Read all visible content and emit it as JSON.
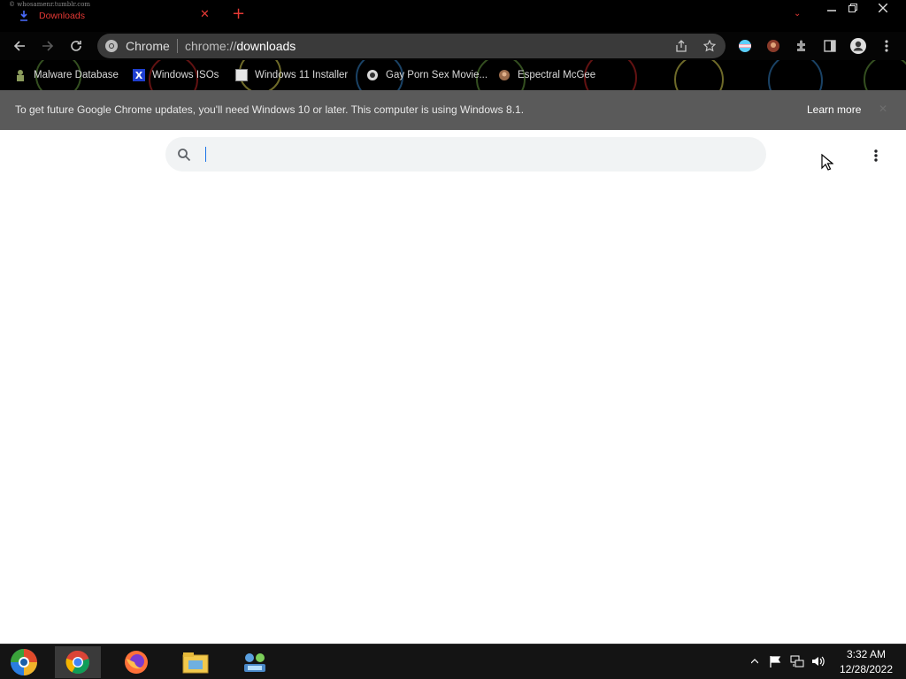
{
  "titlebar": {
    "watermark": "© whosamenr.tumblr.com",
    "tab": {
      "title": "Downloads",
      "icon": "download-icon",
      "close_icon": "close-icon"
    },
    "newtab_icon": "plus-icon",
    "window_controls": [
      "minimize-icon",
      "restore-icon",
      "close-icon"
    ],
    "accent_color": "#e53935"
  },
  "toolbar": {
    "back_icon": "arrow-left-icon",
    "forward_icon": "arrow-right-icon",
    "reload_icon": "reload-icon",
    "omnibox": {
      "chip_label": "Chrome",
      "url_prefix": "chrome://",
      "url_host": "downloads"
    },
    "share_icon": "share-icon",
    "bookmark_icon": "star-icon",
    "right_icons": [
      "profile-flag-icon",
      "extension-avatar-icon",
      "puzzle-icon",
      "side-panel-icon",
      "account-icon",
      "kebab-menu-icon"
    ]
  },
  "bookmarks": [
    {
      "label": "Malware Database",
      "icon": "bookmark-favicon"
    },
    {
      "label": "Windows ISOs",
      "icon": "x-favicon"
    },
    {
      "label": "Windows 11 Installer",
      "icon": "page-favicon"
    },
    {
      "label": "Gay Porn Sex Movie...",
      "icon": "site-favicon"
    },
    {
      "label": "Espectral McGee",
      "icon": "site-favicon"
    }
  ],
  "infobar": {
    "message": "To get future Google Chrome updates, you'll need Windows 10 or later. This computer is using Windows 8.1.",
    "link": "Learn more",
    "close_icon": "close-icon"
  },
  "downloads_page": {
    "search_placeholder": "",
    "search_icon": "search-icon",
    "more_icon": "more-vert-icon"
  },
  "taskbar": {
    "apps": [
      "start-orb",
      "chrome",
      "firefox",
      "file-explorer",
      "network-app"
    ],
    "active_app": "chrome",
    "tray_icons": [
      "show-hidden-icon",
      "flag-icon",
      "network-icon",
      "volume-icon"
    ],
    "time": "3:32 AM",
    "date": "12/28/2022"
  },
  "colors": {
    "chrome_dark": "#000000",
    "omnibox": "#3a3a3a",
    "infobar": "#5a5a5a",
    "search_bg": "#f1f3f4",
    "caret": "#1a73e8",
    "taskbar": "#141414"
  }
}
